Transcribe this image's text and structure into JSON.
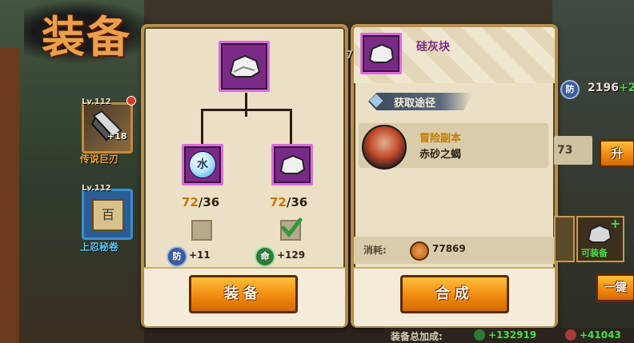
{
  "page_title": "装备",
  "left_items": [
    {
      "level": "Lv.112",
      "plus": "+18",
      "name": "传说巨刃",
      "name_color": "#f0a23a"
    },
    {
      "level": "Lv.112",
      "plus": "",
      "name": "上忍秘卷",
      "name_color": "#5ac8ff",
      "glyph": "百"
    }
  ],
  "recipe_panel": {
    "top_item_icon": "rock-icon",
    "ingredients": [
      {
        "icon": "water-orb-icon",
        "glyph": "水",
        "have": "72",
        "need": "/36",
        "checked": false
      },
      {
        "icon": "rock-icon",
        "have": "72",
        "need": "/36",
        "checked": true
      }
    ],
    "stats": [
      {
        "icon_label": "防",
        "value": "+11",
        "color": "#3c5b9a"
      },
      {
        "icon_label": "命",
        "value": "+129",
        "color": "#2f7a3a"
      }
    ],
    "button_label": "装备"
  },
  "source_panel": {
    "item_name": "硅灰块",
    "source_header": "获取途径",
    "source_entry": {
      "title": "冒险副本",
      "subtitle": "赤砂之蝎"
    },
    "cost_label": "消耗:",
    "cost_value": "77869",
    "button_label": "合成"
  },
  "right_hud": {
    "def_label": "防",
    "def_value": "2196",
    "def_bonus": "+2",
    "partial_number": "73",
    "upgrade_button": "升",
    "equip_card_label": "可装备",
    "one_key_button": "一键",
    "topbar_partial": "7"
  },
  "bottom_bar": {
    "label": "装备总加成:",
    "stat1": "+132919",
    "stat2": "+41043"
  },
  "colors": {
    "accent_orange": "#f08a10",
    "slot_purple": "#7a2a86",
    "panel_bg": "#ebe0c5"
  }
}
